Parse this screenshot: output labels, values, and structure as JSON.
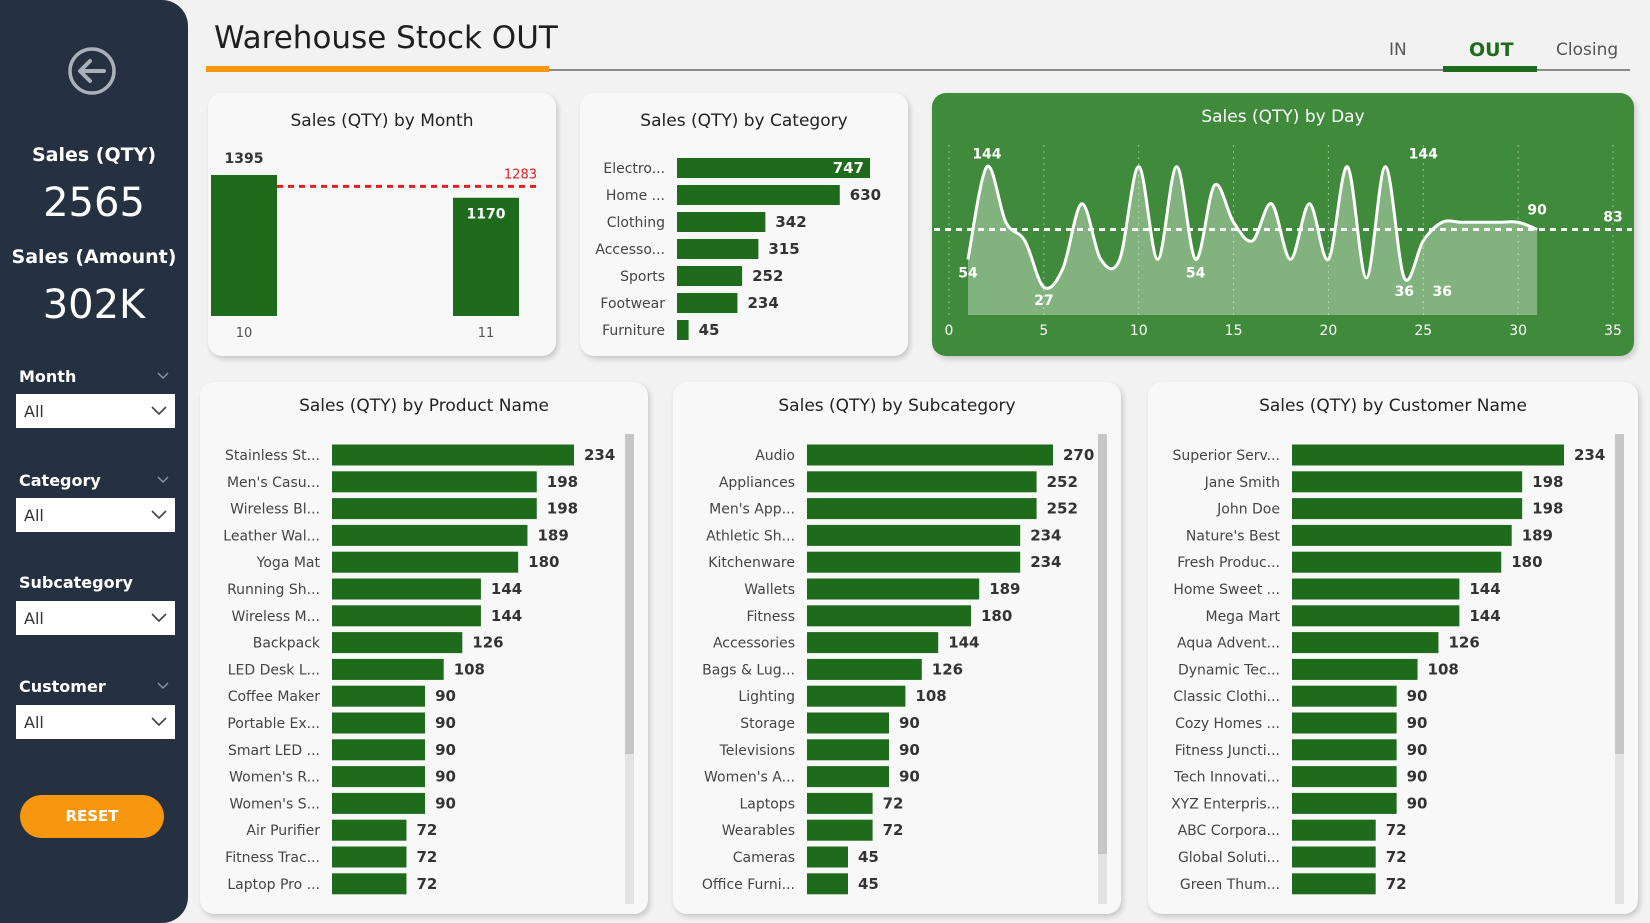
{
  "sidebar": {
    "kpis": [
      {
        "label": "Sales (QTY)",
        "value": "2565"
      },
      {
        "label": "Sales (Amount)",
        "value": "302K"
      }
    ],
    "slicers": [
      {
        "title": "Month",
        "value": "All"
      },
      {
        "title": "Category",
        "value": "All"
      },
      {
        "title": "Subcategory",
        "value": "All"
      },
      {
        "title": "Customer",
        "value": "All"
      }
    ],
    "reset_label": "RESET",
    "back_icon": "back-arrow-icon"
  },
  "header": {
    "title": "Warehouse Stock OUT",
    "tabs": [
      {
        "label": "IN",
        "active": false
      },
      {
        "label": "OUT",
        "active": true
      },
      {
        "label": "Closing",
        "active": false
      }
    ]
  },
  "colors": {
    "bar": "#1e6b1c",
    "accent": "#f7970f",
    "sidebar": "#253141",
    "green_card": "#3f8a3b",
    "target_line": "#e02020"
  },
  "chart_data": [
    {
      "type": "bar",
      "title": "Sales (QTY) by Month",
      "categories": [
        "10",
        "11"
      ],
      "values": [
        1395,
        1170
      ],
      "reference_line": {
        "value": 1283,
        "label": "1283"
      }
    },
    {
      "type": "bar",
      "orientation": "horizontal",
      "title": "Sales (QTY) by Category",
      "categories": [
        "Electro...",
        "Home ...",
        "Clothing",
        "Accesso...",
        "Sports",
        "Footwear",
        "Furniture"
      ],
      "values": [
        747,
        630,
        342,
        315,
        252,
        234,
        45
      ]
    },
    {
      "type": "area",
      "title": "Sales (QTY) by Day",
      "x_ticks": [
        "0",
        "5",
        "10",
        "15",
        "20",
        "25",
        "30",
        "35"
      ],
      "xlim": [
        0,
        35
      ],
      "ylim": [
        0,
        165
      ],
      "x": [
        1,
        2,
        3,
        4,
        5,
        6,
        7,
        8,
        9,
        10,
        11,
        12,
        13,
        14,
        15,
        16,
        17,
        18,
        19,
        20,
        21,
        22,
        23,
        24,
        25,
        26,
        27,
        28,
        29,
        30,
        31
      ],
      "y": [
        54,
        144,
        90,
        72,
        27,
        45,
        108,
        54,
        54,
        144,
        54,
        144,
        54,
        126,
        90,
        72,
        108,
        54,
        108,
        54,
        144,
        36,
        144,
        36,
        72,
        90,
        90,
        90,
        90,
        90,
        83
      ],
      "reference_line": {
        "value": 83
      },
      "data_labels": [
        {
          "x": 1,
          "y": 54,
          "label": "54"
        },
        {
          "x": 2,
          "y": 144,
          "label": "144"
        },
        {
          "x": 5,
          "y": 27,
          "label": "27"
        },
        {
          "x": 13,
          "y": 54,
          "label": "54"
        },
        {
          "x": 25,
          "y": 144,
          "label": "144"
        },
        {
          "x": 24,
          "y": 36,
          "label": "36"
        },
        {
          "x": 26,
          "y": 36,
          "label": "36"
        },
        {
          "x": 31,
          "y": 90,
          "label": "90"
        },
        {
          "x": 35,
          "y": 83,
          "label": "83"
        }
      ]
    },
    {
      "type": "bar",
      "orientation": "horizontal",
      "title": "Sales (QTY) by Product Name",
      "categories": [
        "Stainless St...",
        "Men's Casu...",
        "Wireless Bl...",
        "Leather Wal...",
        "Yoga Mat",
        "Running Sh...",
        "Wireless M...",
        "Backpack",
        "LED Desk L...",
        "Coffee Maker",
        "Portable Ex...",
        "Smart LED ...",
        "Women's R...",
        "Women's S...",
        "Air Purifier",
        "Fitness Trac...",
        "Laptop Pro ..."
      ],
      "values": [
        234,
        198,
        198,
        189,
        180,
        144,
        144,
        126,
        108,
        90,
        90,
        90,
        90,
        90,
        72,
        72,
        72
      ]
    },
    {
      "type": "bar",
      "orientation": "horizontal",
      "title": "Sales (QTY) by Subcategory",
      "categories": [
        "Audio",
        "Appliances",
        "Men's App...",
        "Athletic Sh...",
        "Kitchenware",
        "Wallets",
        "Fitness",
        "Accessories",
        "Bags & Lug...",
        "Lighting",
        "Storage",
        "Televisions",
        "Women's A...",
        "Laptops",
        "Wearables",
        "Cameras",
        "Office Furni..."
      ],
      "values": [
        270,
        252,
        252,
        234,
        234,
        189,
        180,
        144,
        126,
        108,
        90,
        90,
        90,
        72,
        72,
        45,
        45
      ]
    },
    {
      "type": "bar",
      "orientation": "horizontal",
      "title": "Sales (QTY) by Customer Name",
      "categories": [
        "Superior Serv...",
        "Jane Smith",
        "John Doe",
        "Nature's Best",
        "Fresh Produc...",
        "Home Sweet ...",
        "Mega Mart",
        "Aqua Advent...",
        "Dynamic Tec...",
        "Classic Clothi...",
        "Cozy Homes ...",
        "Fitness Juncti...",
        "Tech Innovati...",
        "XYZ Enterpris...",
        "ABC Corpora...",
        "Global Soluti...",
        "Green Thum..."
      ],
      "values": [
        234,
        198,
        198,
        189,
        180,
        144,
        144,
        126,
        108,
        90,
        90,
        90,
        90,
        90,
        72,
        72,
        72
      ]
    }
  ]
}
